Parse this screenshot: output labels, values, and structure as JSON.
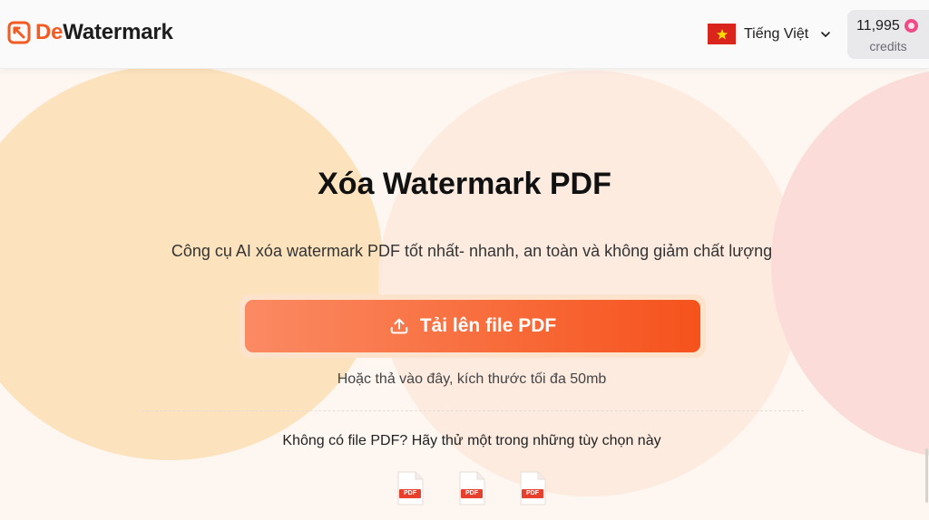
{
  "header": {
    "brand_prefix": "De",
    "brand_suffix": "Watermark",
    "language_label": "Tiếng Việt",
    "credits_value": "11,995",
    "credits_label": "credits"
  },
  "main": {
    "title": "Xóa Watermark PDF",
    "subtitle": "Công cụ AI xóa watermark PDF tốt nhất- nhanh, an toàn và không giảm chất lượng",
    "upload_label": "Tải lên file PDF",
    "hint": "Hoặc thả vào đây, kích thước tối đa 50mb",
    "no_file_prompt": "Không có file PDF? Hãy thử một trong những tùy chọn này"
  },
  "samples": [
    {
      "label": "PDF"
    },
    {
      "label": "PDF"
    },
    {
      "label": "PDF"
    }
  ],
  "colors": {
    "accent": "#f25b22",
    "button_start": "#fb8a63",
    "button_end": "#f6521c",
    "flag_red": "#da251d",
    "flag_star": "#ffde00",
    "credit_coin": "#f04a86"
  },
  "icons": {
    "logo": "dewatermark-logo-icon",
    "language_flag": "vietnam-flag-icon",
    "language_chevron": "chevron-down-icon",
    "credits": "coin-icon",
    "upload": "upload-icon",
    "sample_file": "pdf-file-icon"
  }
}
